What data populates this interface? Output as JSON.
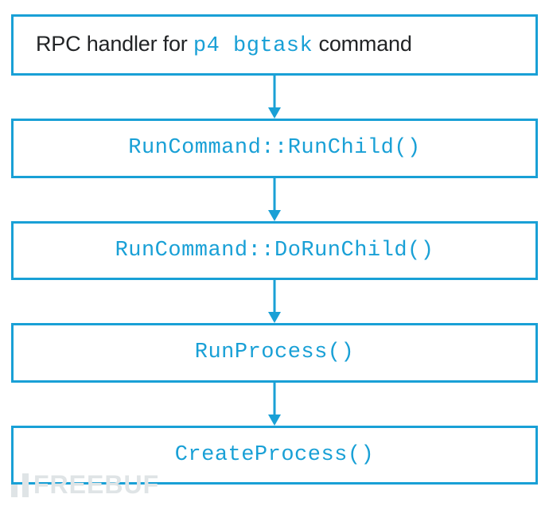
{
  "diagram": {
    "accent_color": "#19a0d6",
    "nodes": [
      {
        "id": "rpc-handler",
        "plain_prefix": "RPC handler for ",
        "code_text": "p4 bgtask",
        "plain_suffix": " command"
      },
      {
        "id": "run-child",
        "code_text": "RunCommand::RunChild()"
      },
      {
        "id": "do-run-child",
        "code_text": "RunCommand::DoRunChild()"
      },
      {
        "id": "run-process",
        "code_text": "RunProcess()"
      },
      {
        "id": "create-process",
        "code_text": "CreateProcess()"
      }
    ],
    "edges": [
      {
        "from": "rpc-handler",
        "to": "run-child"
      },
      {
        "from": "run-child",
        "to": "do-run-child"
      },
      {
        "from": "do-run-child",
        "to": "run-process"
      },
      {
        "from": "run-process",
        "to": "create-process"
      }
    ]
  },
  "watermark": {
    "text": "FREEBUF"
  }
}
